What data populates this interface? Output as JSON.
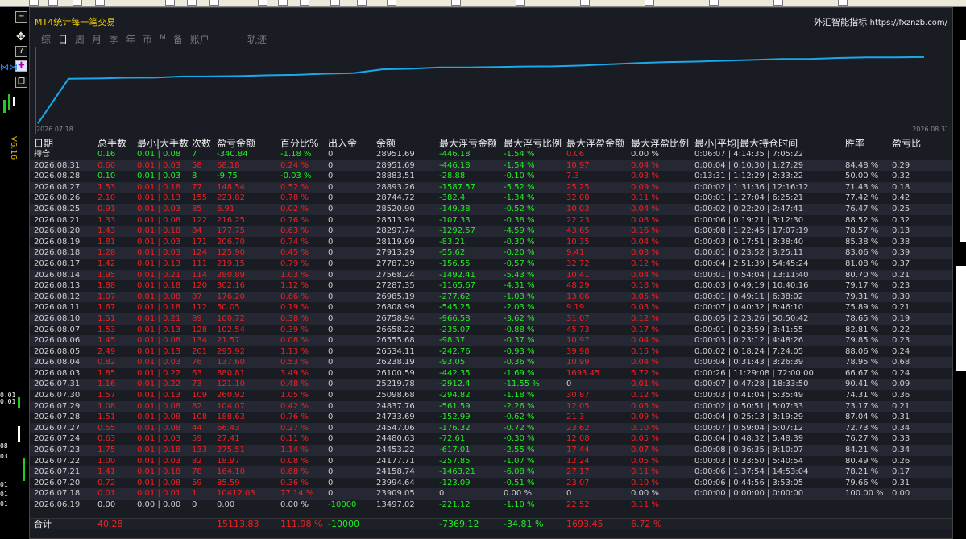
{
  "panel": {
    "title": "MT4统计每一笔交易",
    "brand": "外汇智能指标",
    "url": "https://fxznzb.com/"
  },
  "side_label": "V6.16",
  "tabs": [
    {
      "label": "综",
      "active": false
    },
    {
      "label": "日",
      "active": true
    },
    {
      "label": "周",
      "active": false
    },
    {
      "label": "月",
      "active": false
    },
    {
      "label": "季",
      "active": false
    },
    {
      "label": "年",
      "active": false
    },
    {
      "label": "币",
      "active": false
    },
    {
      "label": "M",
      "active": false
    },
    {
      "label": "备",
      "active": false
    },
    {
      "label": "账户",
      "active": false
    },
    {
      "label": "轨迹",
      "active": false
    }
  ],
  "chart_data": {
    "type": "line",
    "x_start": "2026.07.18",
    "x_end": "2026.08.31",
    "series_color": "#1aa8e8",
    "y": [
      13497.02,
      23909.05,
      23994.64,
      24158.74,
      24177.71,
      24453.22,
      24480.63,
      24547.06,
      24733.69,
      24837.76,
      25098.68,
      25219.78,
      26100.59,
      26238.19,
      26534.11,
      26555.68,
      26658.22,
      26758.94,
      26808.99,
      26985.19,
      27287.35,
      27568.24,
      27787.39,
      27913.29,
      28119.99,
      28297.74,
      28513.99,
      28520.9,
      28744.72,
      28893.26,
      28883.51,
      28951.69
    ]
  },
  "columns": {
    "date": "日期",
    "count": "总手数",
    "lots": "最小|大手数",
    "n": "次数",
    "pl": "盈亏金额",
    "pct": "百分比%",
    "dep": "出入金",
    "bal": "余额",
    "fl": "最大浮亏金额",
    "flp": "最大浮亏比例",
    "fp": "最大浮盈金额",
    "fpp": "最大浮盈比例",
    "time": "最小|平均|最大持仓时间",
    "wr": "胜率",
    "pr": "盈亏比"
  },
  "rows": [
    {
      "date": "持仓",
      "count": "0.16",
      "lots": "0.01 | 0.08",
      "n": "7",
      "pl": "-340.84",
      "pct": "-1.18 %",
      "dep": "0",
      "bal": "28951.69",
      "fl": "-446.18",
      "flp": "-1.54 %",
      "fp": "0.06",
      "fpp": "0.00 %",
      "time": "0:06:07 | 4:14:35 | 7:05:22",
      "wr": "",
      "pr": "",
      "color": "green"
    },
    {
      "date": "2026.08.31",
      "count": "0.60",
      "lots": "0.01 | 0.03",
      "n": "58",
      "pl": "68.18",
      "pct": "0.24 %",
      "dep": "0",
      "bal": "28951.69",
      "fl": "-446.18",
      "flp": "-1.54 %",
      "fp": "10.97",
      "fpp": "0.04 %",
      "time": "0:00:04 | 0:10:30 | 1:27:29",
      "wr": "84.48 %",
      "pr": "0.29",
      "color": "red"
    },
    {
      "date": "2026.08.28",
      "count": "0.10",
      "lots": "0.01 | 0.03",
      "n": "8",
      "pl": "-9.75",
      "pct": "-0.03 %",
      "dep": "0",
      "bal": "28883.51",
      "fl": "-28.88",
      "flp": "-0.10 %",
      "fp": "7.3",
      "fpp": "0.03 %",
      "time": "0:13:31 | 1:12:29 | 2:33:22",
      "wr": "50.00 %",
      "pr": "0.32",
      "color": "green"
    },
    {
      "date": "2026.08.27",
      "count": "1.53",
      "lots": "0.01 | 0.18",
      "n": "77",
      "pl": "148.54",
      "pct": "0.52 %",
      "dep": "0",
      "bal": "28893.26",
      "fl": "-1587.57",
      "flp": "-5.52 %",
      "fp": "25.25",
      "fpp": "0.09 %",
      "time": "0:00:02 | 1:31:36 | 12:16:12",
      "wr": "71.43 %",
      "pr": "0.18",
      "color": "red"
    },
    {
      "date": "2026.08.26",
      "count": "2.10",
      "lots": "0.01 | 0.13",
      "n": "155",
      "pl": "223.82",
      "pct": "0.78 %",
      "dep": "0",
      "bal": "28744.72",
      "fl": "-382.4",
      "flp": "-1.34 %",
      "fp": "32.08",
      "fpp": "0.11 %",
      "time": "0:00:01 | 1:27:04 | 6:25:21",
      "wr": "77.42 %",
      "pr": "0.42",
      "color": "red"
    },
    {
      "date": "2026.08.25",
      "count": "0.91",
      "lots": "0.01 | 0.03",
      "n": "85",
      "pl": "6.91",
      "pct": "0.02 %",
      "dep": "0",
      "bal": "28520.90",
      "fl": "-149.38",
      "flp": "-0.52 %",
      "fp": "10.03",
      "fpp": "0.04 %",
      "time": "0:00:02 | 0:22:20 | 2:47:41",
      "wr": "76.47 %",
      "pr": "0.25",
      "color": "red"
    },
    {
      "date": "2026.08.21",
      "count": "1.33",
      "lots": "0.01 | 0.08",
      "n": "122",
      "pl": "216.25",
      "pct": "0.76 %",
      "dep": "0",
      "bal": "28513.99",
      "fl": "-107.33",
      "flp": "-0.38 %",
      "fp": "22.23",
      "fpp": "0.08 %",
      "time": "0:00:06 | 0:19:21 | 3:12:30",
      "wr": "88.52 %",
      "pr": "0.32",
      "color": "red"
    },
    {
      "date": "2026.08.20",
      "count": "1.43",
      "lots": "0.01 | 0.18",
      "n": "84",
      "pl": "177.75",
      "pct": "0.63 %",
      "dep": "0",
      "bal": "28297.74",
      "fl": "-1292.57",
      "flp": "-4.59 %",
      "fp": "43.65",
      "fpp": "0.16 %",
      "time": "0:00:08 | 1:22:45 | 17:07:19",
      "wr": "78.57 %",
      "pr": "0.13",
      "color": "red"
    },
    {
      "date": "2026.08.19",
      "count": "1.81",
      "lots": "0.01 | 0.03",
      "n": "171",
      "pl": "206.70",
      "pct": "0.74 %",
      "dep": "0",
      "bal": "28119.99",
      "fl": "-83.21",
      "flp": "-0.30 %",
      "fp": "10.35",
      "fpp": "0.04 %",
      "time": "0:00:03 | 0:17:51 | 3:38:40",
      "wr": "85.38 %",
      "pr": "0.38",
      "color": "red"
    },
    {
      "date": "2026.08.18",
      "count": "1.28",
      "lots": "0.01 | 0.03",
      "n": "124",
      "pl": "125.90",
      "pct": "0.45 %",
      "dep": "0",
      "bal": "27913.29",
      "fl": "-55.62",
      "flp": "-0.20 %",
      "fp": "9.41",
      "fpp": "0.03 %",
      "time": "0:00:01 | 0:23:52 | 3:25:11",
      "wr": "83.06 %",
      "pr": "0.39",
      "color": "red"
    },
    {
      "date": "2026.08.17",
      "count": "1.42",
      "lots": "0.01 | 0.13",
      "n": "111",
      "pl": "219.15",
      "pct": "0.79 %",
      "dep": "0",
      "bal": "27787.39",
      "fl": "-156.55",
      "flp": "-0.57 %",
      "fp": "32.72",
      "fpp": "0.12 %",
      "time": "0:00:04 | 2:51:39 | 54:45:24",
      "wr": "81.08 %",
      "pr": "0.37",
      "color": "red"
    },
    {
      "date": "2026.08.14",
      "count": "1.95",
      "lots": "0.01 | 0.21",
      "n": "114",
      "pl": "280.89",
      "pct": "1.03 %",
      "dep": "0",
      "bal": "27568.24",
      "fl": "-1492.41",
      "flp": "-5.43 %",
      "fp": "10.41",
      "fpp": "0.04 %",
      "time": "0:00:01 | 0:54:04 | 13:11:40",
      "wr": "80.70 %",
      "pr": "0.21",
      "color": "red"
    },
    {
      "date": "2026.08.13",
      "count": "1.88",
      "lots": "0.01 | 0.18",
      "n": "120",
      "pl": "302.16",
      "pct": "1.12 %",
      "dep": "0",
      "bal": "27287.35",
      "fl": "-1165.67",
      "flp": "-4.31 %",
      "fp": "48.29",
      "fpp": "0.18 %",
      "time": "0:00:03 | 0:49:19 | 10:40:16",
      "wr": "79.17 %",
      "pr": "0.23",
      "color": "red"
    },
    {
      "date": "2026.08.12",
      "count": "1.07",
      "lots": "0.01 | 0.08",
      "n": "87",
      "pl": "176.20",
      "pct": "0.66 %",
      "dep": "0",
      "bal": "26985.19",
      "fl": "-277.62",
      "flp": "-1.03 %",
      "fp": "13.06",
      "fpp": "0.05 %",
      "time": "0:00:01 | 0:49:11 | 6:38:02",
      "wr": "79.31 %",
      "pr": "0.30",
      "color": "red"
    },
    {
      "date": "2026.08.11",
      "count": "1.67",
      "lots": "0.01 | 0.18",
      "n": "112",
      "pl": "50.05",
      "pct": "0.19 %",
      "dep": "0",
      "bal": "26808.99",
      "fl": "-545.25",
      "flp": "-2.03 %",
      "fp": "9.19",
      "fpp": "0.03 %",
      "time": "0:00:07 | 0:40:32 | 8:46:10",
      "wr": "75.89 %",
      "pr": "0.21",
      "color": "red"
    },
    {
      "date": "2026.08.10",
      "count": "1.51",
      "lots": "0.01 | 0.21",
      "n": "89",
      "pl": "100.72",
      "pct": "0.38 %",
      "dep": "0",
      "bal": "26758.94",
      "fl": "-966.58",
      "flp": "-3.62 %",
      "fp": "31.07",
      "fpp": "0.12 %",
      "time": "0:00:05 | 2:23:26 | 50:50:42",
      "wr": "78.65 %",
      "pr": "0.19",
      "color": "red"
    },
    {
      "date": "2026.08.07",
      "count": "1.53",
      "lots": "0.01 | 0.13",
      "n": "128",
      "pl": "102.54",
      "pct": "0.39 %",
      "dep": "0",
      "bal": "26658.22",
      "fl": "-235.07",
      "flp": "-0.88 %",
      "fp": "45.73",
      "fpp": "0.17 %",
      "time": "0:00:01 | 0:23:59 | 3:41:55",
      "wr": "82.81 %",
      "pr": "0.22",
      "color": "red"
    },
    {
      "date": "2026.08.06",
      "count": "1.45",
      "lots": "0.01 | 0.08",
      "n": "134",
      "pl": "21.57",
      "pct": "0.08 %",
      "dep": "0",
      "bal": "26555.68",
      "fl": "-98.37",
      "flp": "-0.37 %",
      "fp": "10.97",
      "fpp": "0.04 %",
      "time": "0:00:03 | 0:23:12 | 4:48:26",
      "wr": "79.85 %",
      "pr": "0.23",
      "color": "red"
    },
    {
      "date": "2026.08.05",
      "count": "2.49",
      "lots": "0.01 | 0.13",
      "n": "201",
      "pl": "295.92",
      "pct": "1.13 %",
      "dep": "0",
      "bal": "26534.11",
      "fl": "-242.76",
      "flp": "-0.93 %",
      "fp": "39.98",
      "fpp": "0.15 %",
      "time": "0:00:02 | 0:18:24 | 7:24:05",
      "wr": "88.06 %",
      "pr": "0.24",
      "color": "red"
    },
    {
      "date": "2026.08.04",
      "count": "0.82",
      "lots": "0.01 | 0.03",
      "n": "76",
      "pl": "137.60",
      "pct": "0.53 %",
      "dep": "0",
      "bal": "26238.19",
      "fl": "-93.05",
      "flp": "-0.36 %",
      "fp": "10.99",
      "fpp": "0.04 %",
      "time": "0:00:04 | 0:31:43 | 3:26:39",
      "wr": "78.95 %",
      "pr": "0.68",
      "color": "red"
    },
    {
      "date": "2026.08.03",
      "count": "1.85",
      "lots": "0.01 | 0.22",
      "n": "63",
      "pl": "880.81",
      "pct": "3.49 %",
      "dep": "0",
      "bal": "26100.59",
      "fl": "-442.35",
      "flp": "-1.69 %",
      "fp": "1693.45",
      "fpp": "6.72 %",
      "time": "0:00:26 | 11:29:08 | 72:00:00",
      "wr": "66.67 %",
      "pr": "0.24",
      "color": "red"
    },
    {
      "date": "2026.07.31",
      "count": "1.16",
      "lots": "0.01 | 0.22",
      "n": "73",
      "pl": "121.10",
      "pct": "0.48 %",
      "dep": "0",
      "bal": "25219.78",
      "fl": "-2912.4",
      "flp": "-11.55 %",
      "fp": "0",
      "fpp": "0.01 %",
      "time": "0:00:07 | 0:47:28 | 18:33:50",
      "wr": "90.41 %",
      "pr": "0.09",
      "color": "red"
    },
    {
      "date": "2026.07.30",
      "count": "1.57",
      "lots": "0.01 | 0.13",
      "n": "109",
      "pl": "260.92",
      "pct": "1.05 %",
      "dep": "0",
      "bal": "25098.68",
      "fl": "-294.82",
      "flp": "-1.18 %",
      "fp": "30.87",
      "fpp": "0.12 %",
      "time": "0:00:03 | 0:41:04 | 5:35:49",
      "wr": "74.31 %",
      "pr": "0.36",
      "color": "red"
    },
    {
      "date": "2026.07.29",
      "count": "1.08",
      "lots": "0.01 | 0.08",
      "n": "82",
      "pl": "104.07",
      "pct": "0.42 %",
      "dep": "0",
      "bal": "24837.76",
      "fl": "-561.59",
      "flp": "-2.26 %",
      "fp": "12.05",
      "fpp": "0.05 %",
      "time": "0:00:02 | 0:50:51 | 5:07:33",
      "wr": "73.17 %",
      "pr": "0.21",
      "color": "red"
    },
    {
      "date": "2026.07.28",
      "count": "1.51",
      "lots": "0.01 | 0.08",
      "n": "108",
      "pl": "188.63",
      "pct": "0.76 %",
      "dep": "0",
      "bal": "24733.69",
      "fl": "-152.99",
      "flp": "-0.62 %",
      "fp": "21.3",
      "fpp": "0.09 %",
      "time": "0:00:04 | 0:25:13 | 3:19:29",
      "wr": "87.04 %",
      "pr": "0.31",
      "color": "red"
    },
    {
      "date": "2026.07.27",
      "count": "0.55",
      "lots": "0.01 | 0.08",
      "n": "44",
      "pl": "66.43",
      "pct": "0.27 %",
      "dep": "0",
      "bal": "24547.06",
      "fl": "-176.32",
      "flp": "-0.72 %",
      "fp": "23.62",
      "fpp": "0.10 %",
      "time": "0:00:07 | 0:59:04 | 5:07:12",
      "wr": "72.73 %",
      "pr": "0.34",
      "color": "red"
    },
    {
      "date": "2026.07.24",
      "count": "0.63",
      "lots": "0.01 | 0.03",
      "n": "59",
      "pl": "27.41",
      "pct": "0.11 %",
      "dep": "0",
      "bal": "24480.63",
      "fl": "-72.61",
      "flp": "-0.30 %",
      "fp": "12.08",
      "fpp": "0.05 %",
      "time": "0:00:04 | 0:48:32 | 5:48:39",
      "wr": "76.27 %",
      "pr": "0.33",
      "color": "red"
    },
    {
      "date": "2026.07.23",
      "count": "1.75",
      "lots": "0.01 | 0.18",
      "n": "133",
      "pl": "275.51",
      "pct": "1.14 %",
      "dep": "0",
      "bal": "24453.22",
      "fl": "-617.01",
      "flp": "-2.55 %",
      "fp": "17.44",
      "fpp": "0.07 %",
      "time": "0:00:08 | 0:36:35 | 9:10:07",
      "wr": "84.21 %",
      "pr": "0.34",
      "color": "red"
    },
    {
      "date": "2026.07.22",
      "count": "1.00",
      "lots": "0.01 | 0.03",
      "n": "82",
      "pl": "18.97",
      "pct": "0.08 %",
      "dep": "0",
      "bal": "24177.71",
      "fl": "-257.85",
      "flp": "-1.07 %",
      "fp": "12.24",
      "fpp": "0.05 %",
      "time": "0:00:03 | 0:33:50 | 5:40:54",
      "wr": "80.49 %",
      "pr": "0.26",
      "color": "red"
    },
    {
      "date": "2026.07.21",
      "count": "1.41",
      "lots": "0.01 | 0.18",
      "n": "78",
      "pl": "164.10",
      "pct": "0.68 %",
      "dep": "0",
      "bal": "24158.74",
      "fl": "-1463.21",
      "flp": "-6.08 %",
      "fp": "27.17",
      "fpp": "0.11 %",
      "time": "0:00:06 | 1:37:54 | 14:53:04",
      "wr": "78.21 %",
      "pr": "0.17",
      "color": "red"
    },
    {
      "date": "2026.07.20",
      "count": "0.72",
      "lots": "0.01 | 0.08",
      "n": "59",
      "pl": "85.59",
      "pct": "0.36 %",
      "dep": "0",
      "bal": "23994.64",
      "fl": "-123.09",
      "flp": "-0.51 %",
      "fp": "23.07",
      "fpp": "0.10 %",
      "time": "0:00:06 | 0:44:56 | 3:53:05",
      "wr": "79.66 %",
      "pr": "0.31",
      "color": "red"
    },
    {
      "date": "2026.07.18",
      "count": "0.01",
      "lots": "0.01 | 0.01",
      "n": "1",
      "pl": "10412.03",
      "pct": "77.14 %",
      "dep": "0",
      "bal": "23909.05",
      "fl": "0",
      "flp": "0.00 %",
      "fp": "0",
      "fpp": "0.00 %",
      "time": "0:00:00 | 0:00:00 | 0:00:00",
      "wr": "100.00 %",
      "pr": "0.00",
      "color": "red"
    },
    {
      "date": "2026.06.19",
      "count": "0.00",
      "lots": "0.00 | 0.00",
      "n": "0",
      "pl": "0.00",
      "pct": "0.00 %",
      "dep": "-10000",
      "bal": "13497.02",
      "fl": "-221.12",
      "flp": "-1.10 %",
      "fp": "22.52",
      "fpp": "0.11 %",
      "time": "",
      "wr": "",
      "pr": "",
      "color": "white"
    }
  ],
  "total": {
    "date": "合计",
    "count": "40.28",
    "pl": "15113.83",
    "pct": "111.98 %",
    "dep": "-10000",
    "fl": "-7369.12",
    "flp": "-34.81 %",
    "fp": "1693.45",
    "fpp": "6.72 %"
  },
  "side_prices": [
    "0.01",
    "0.01",
    "08",
    "03",
    "01",
    "01",
    "01"
  ]
}
